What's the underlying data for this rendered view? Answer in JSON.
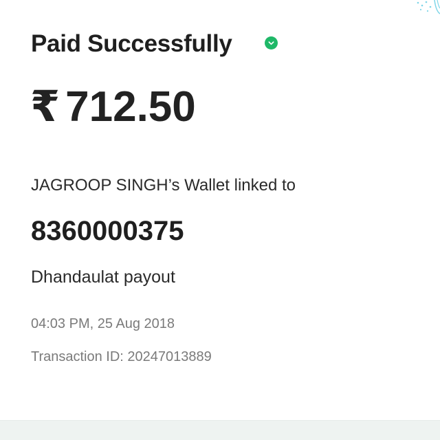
{
  "payment": {
    "status_title": "Paid Successfully",
    "status_icon": "check-circle-icon",
    "status_color": "#1fb868",
    "currency_symbol": "₹",
    "amount": "712.50",
    "linked_text": "JAGROOP SINGH’s Wallet linked to",
    "phone_number": "8360000375",
    "note": "Dhandaulat payout",
    "timestamp": "04:03 PM, 25 Aug 2018",
    "transaction_id": "Transaction ID: 20247013889"
  }
}
